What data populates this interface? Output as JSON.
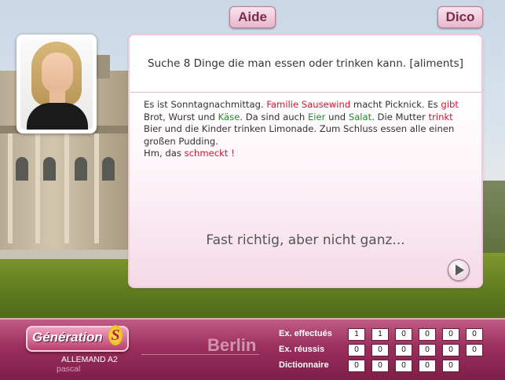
{
  "toolbar": {
    "help_label": "Aide",
    "dictionary_label": "Dico"
  },
  "exercise": {
    "instruction": "Suche 8 Dinge die man essen oder trinken kann. [aliments]",
    "story": [
      {
        "t": "Es ist Sonntagnachmittag. ",
        "c": "plain"
      },
      {
        "t": "Familie Sausewind",
        "c": "red"
      },
      {
        "t": " macht Picknick. Es ",
        "c": "plain"
      },
      {
        "t": "gibt",
        "c": "red"
      },
      {
        "t": " Brot, Wurst und ",
        "c": "plain"
      },
      {
        "t": "Käse",
        "c": "green"
      },
      {
        "t": ". Da sind auch ",
        "c": "plain"
      },
      {
        "t": "Eier",
        "c": "green"
      },
      {
        "t": " und ",
        "c": "plain"
      },
      {
        "t": "Salat",
        "c": "green"
      },
      {
        "t": ". Die Mutter ",
        "c": "plain"
      },
      {
        "t": "trinkt",
        "c": "red"
      },
      {
        "t": " Bier und die Kinder trinken Limonade. Zum Schluss essen alle einen großen Pudding.",
        "c": "plain"
      },
      {
        "t": "\n",
        "c": "break"
      },
      {
        "t": "Hm, das ",
        "c": "plain"
      },
      {
        "t": "schmeckt !",
        "c": "red"
      }
    ],
    "feedback": "Fast richtig, aber nicht ganz..."
  },
  "footer": {
    "brand": "Génération",
    "brand_mark": "S",
    "level": "ALLEMAND A2",
    "user": "pascal",
    "city": "Berlin",
    "stats": [
      {
        "label": "Ex. effectués",
        "values": [
          "1",
          "1",
          "0",
          "0",
          "0",
          "0"
        ]
      },
      {
        "label": "Ex. réussis",
        "values": [
          "0",
          "0",
          "0",
          "0",
          "0",
          "0"
        ]
      },
      {
        "label": "Dictionnaire",
        "values": [
          "0",
          "0",
          "0",
          "0",
          "0"
        ]
      }
    ]
  },
  "colors": {
    "accent_red": "#d3162f",
    "accent_green": "#1f8a2e",
    "bar_pink": "#9b2f5d"
  }
}
